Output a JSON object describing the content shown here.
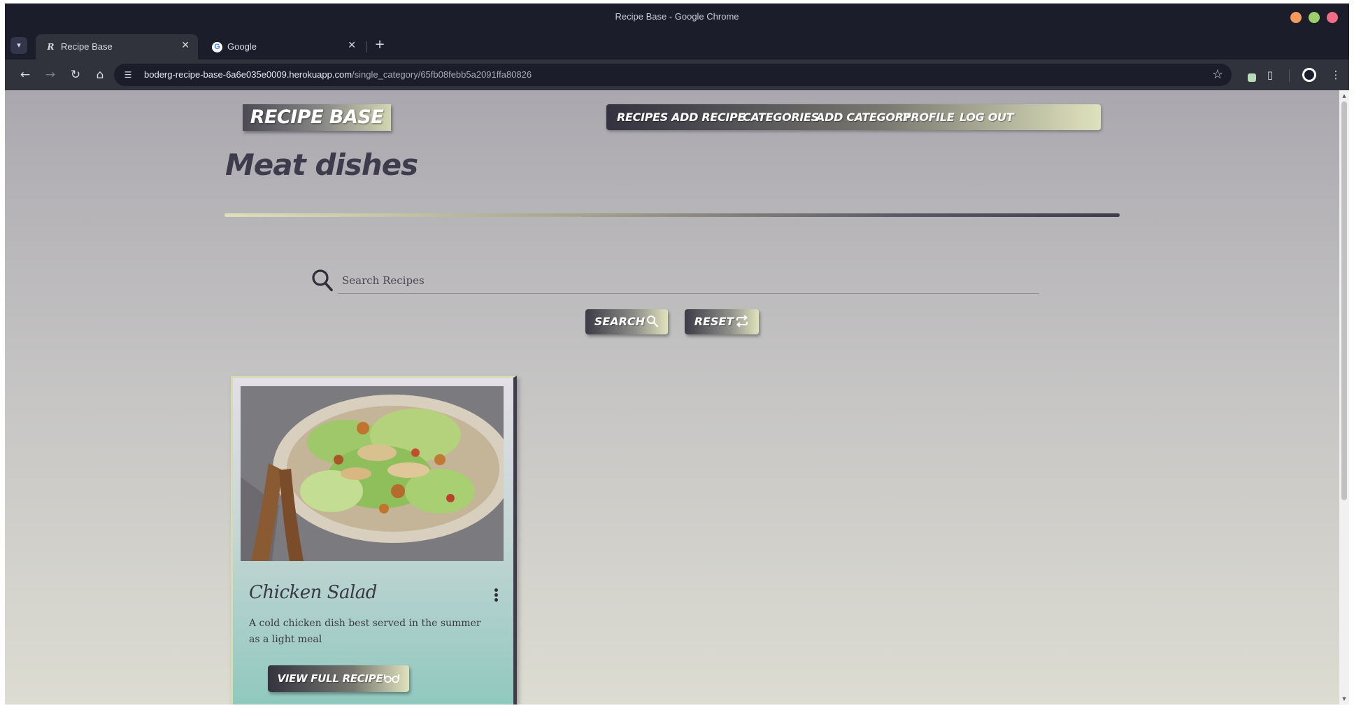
{
  "browser": {
    "window_title": "Recipe Base - Google Chrome",
    "tabs": [
      {
        "label": "Recipe Base",
        "favicon": "R"
      },
      {
        "label": "Google",
        "favicon": "G"
      }
    ],
    "url_host": "boderg-recipe-base-6a6e035e0009.herokuapp.com",
    "url_path": "/single_category/65fb08febb5a2091ffa80826"
  },
  "site": {
    "logo": "RECIPE BASE",
    "nav": [
      "RECIPES",
      "ADD RECIPE",
      "CATEGORIES",
      "ADD CATEGORY",
      "PROFILE",
      "LOG OUT"
    ]
  },
  "page": {
    "title": "Meat dishes",
    "search": {
      "placeholder": "Search Recipes",
      "value": "",
      "search_button": "SEARCH",
      "reset_button": "RESET"
    },
    "recipes": [
      {
        "title": "Chicken Salad",
        "description": "A cold chicken dish best served in the summer as a light meal",
        "button": "VIEW FULL RECIPE"
      }
    ]
  },
  "colors": {
    "accent_dark": "#3e3b4c",
    "accent_light": "#dfe2bd",
    "card_teal": "#8ac7bc"
  },
  "icons": {
    "search": "magnifier-icon",
    "reset": "repeat-icon",
    "view_recipe": "glasses-icon",
    "card_menu": "kebab-icon"
  }
}
